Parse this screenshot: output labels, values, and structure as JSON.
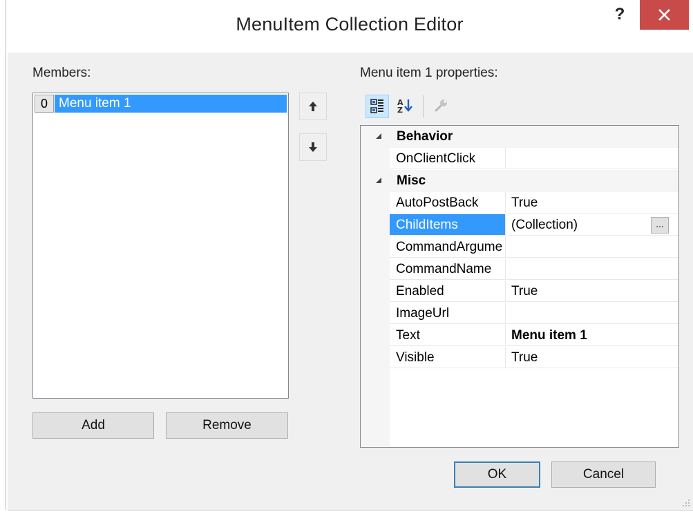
{
  "window": {
    "title": "MenuItem Collection Editor",
    "help_label": "?"
  },
  "members": {
    "label": "Members:",
    "items": [
      {
        "index": "0",
        "name": "Menu item 1"
      }
    ],
    "add_label": "Add",
    "remove_label": "Remove"
  },
  "properties": {
    "label": "Menu item 1 properties:",
    "categories": [
      {
        "name": "Behavior",
        "props": [
          {
            "name": "OnClientClick",
            "value": ""
          }
        ]
      },
      {
        "name": "Misc",
        "props": [
          {
            "name": "AutoPostBack",
            "value": "True"
          },
          {
            "name": "ChildItems",
            "value": "(Collection)",
            "selected": true,
            "ellipsis": "..."
          },
          {
            "name": "CommandArgume",
            "value": ""
          },
          {
            "name": "CommandName",
            "value": ""
          },
          {
            "name": "Enabled",
            "value": "True"
          },
          {
            "name": "ImageUrl",
            "value": ""
          },
          {
            "name": "Text",
            "value": "Menu item 1",
            "bold": true
          },
          {
            "name": "Visible",
            "value": "True"
          }
        ]
      }
    ]
  },
  "footer": {
    "ok_label": "OK",
    "cancel_label": "Cancel"
  },
  "colors": {
    "close_button": "#c94b49",
    "selection": "#3399ff",
    "client_bg": "#f0f0f0"
  },
  "icons": [
    "help-icon",
    "close-icon",
    "move-up-icon",
    "move-down-icon",
    "categorized-icon",
    "alphabetical-icon",
    "property-pages-icon",
    "collapse-icon",
    "size-grip-icon"
  ]
}
